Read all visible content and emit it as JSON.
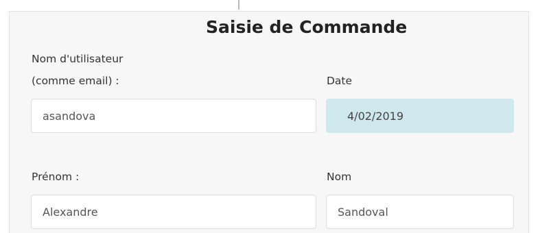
{
  "form": {
    "title": "Saisie de Commande",
    "username": {
      "label_line1": "Nom d'utilisateur",
      "label_line2": "(comme email) :",
      "value": "asandova"
    },
    "date": {
      "label": "Date",
      "value": "4/02/2019"
    },
    "first_name": {
      "label": "Prénom :",
      "value": "Alexandre"
    },
    "last_name": {
      "label": "Nom",
      "value": "Sandoval"
    }
  },
  "colors": {
    "panel_background": "#f7f7f7",
    "date_field_background": "#cfe8ed",
    "field_border": "#dcdcdc"
  }
}
